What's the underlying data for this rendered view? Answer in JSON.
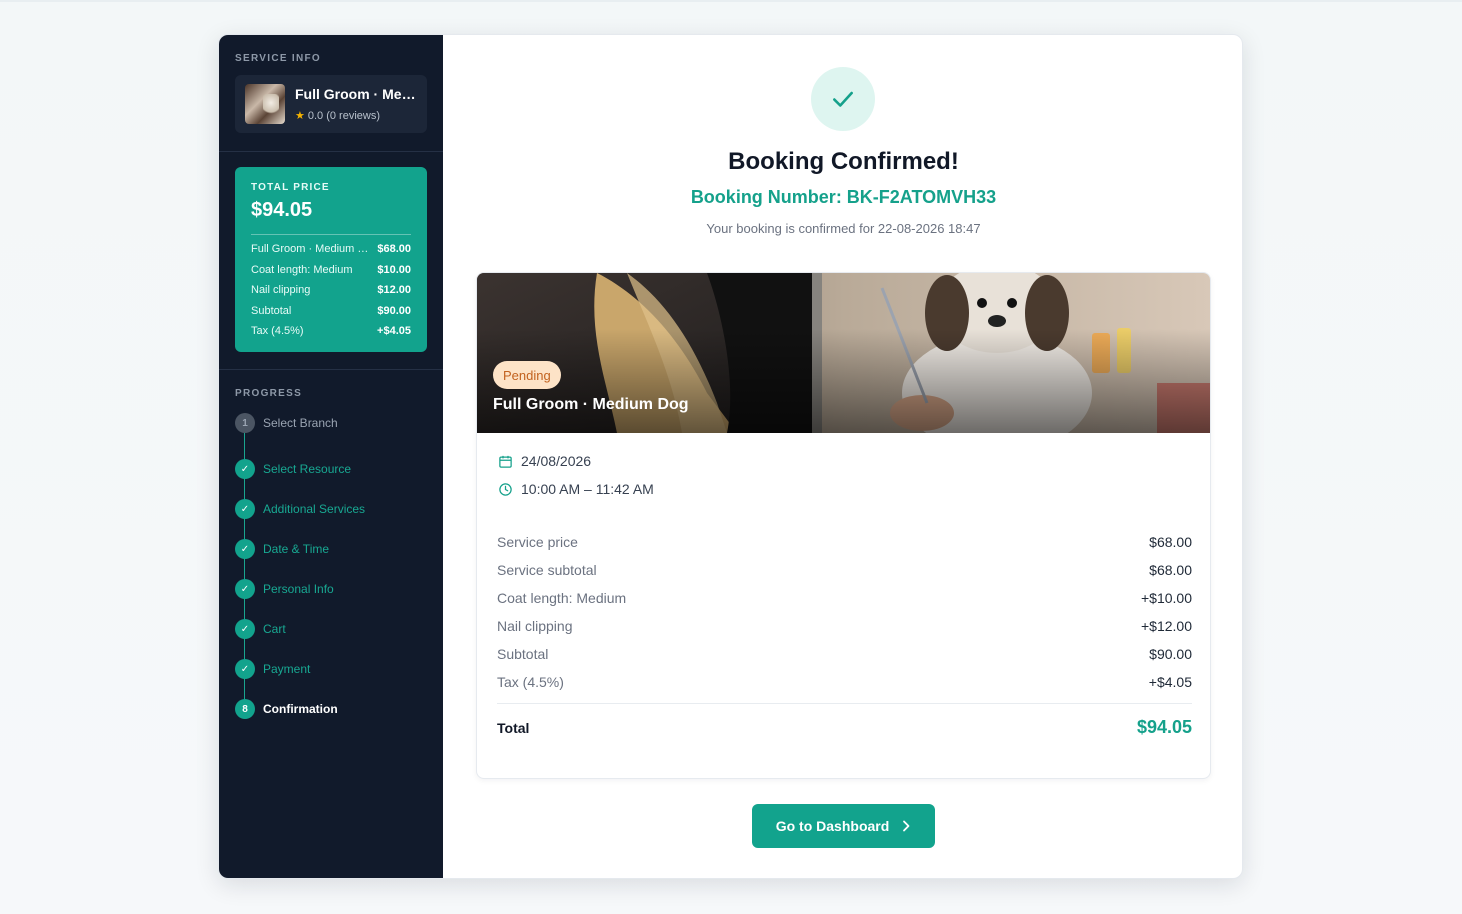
{
  "sidebar": {
    "service_info_label": "SERVICE INFO",
    "service_name": "Full Groom · Medium Dog",
    "rating": "0.0 (0 reviews)",
    "price": {
      "label": "TOTAL PRICE",
      "total": "$94.05",
      "rows": [
        {
          "label": "Full Groom · Medium Dog",
          "value": "$68.00"
        },
        {
          "label": "Coat length: Medium",
          "value": "$10.00"
        },
        {
          "label": "Nail clipping",
          "value": "$12.00"
        },
        {
          "label": "Subtotal",
          "value": "$90.00"
        },
        {
          "label": "Tax (4.5%)",
          "value": "+$4.05"
        }
      ]
    },
    "progress_label": "PROGRESS",
    "steps": [
      {
        "num": "1",
        "label": "Select Branch",
        "state": "pending"
      },
      {
        "num": "✓",
        "label": "Select Resource",
        "state": "done"
      },
      {
        "num": "✓",
        "label": "Additional Services",
        "state": "done"
      },
      {
        "num": "✓",
        "label": "Date & Time",
        "state": "done"
      },
      {
        "num": "✓",
        "label": "Personal Info",
        "state": "done"
      },
      {
        "num": "✓",
        "label": "Cart",
        "state": "done"
      },
      {
        "num": "✓",
        "label": "Payment",
        "state": "done"
      },
      {
        "num": "8",
        "label": "Confirmation",
        "state": "active"
      }
    ]
  },
  "main": {
    "title": "Booking Confirmed!",
    "booking_number": "Booking Number: BK-F2ATOMVH33",
    "subtitle": "Your booking is confirmed for 22-08-2026 18:47",
    "status_badge": "Pending",
    "service_title": "Full Groom · Medium Dog",
    "date": "24/08/2026",
    "time": "10:00 AM – 11:42 AM",
    "lines": [
      {
        "label": "Service price",
        "value": "$68.00"
      },
      {
        "label": "Service subtotal",
        "value": "$68.00"
      },
      {
        "label": "Coat length: Medium",
        "value": "+$10.00"
      },
      {
        "label": "Nail clipping",
        "value": "+$12.00"
      },
      {
        "label": "Subtotal",
        "value": "$90.00"
      },
      {
        "label": "Tax (4.5%)",
        "value": "+$4.05"
      }
    ],
    "total_label": "Total",
    "total_value": "$94.05",
    "dashboard_button": "Go to Dashboard"
  },
  "colors": {
    "accent": "#12a38d",
    "sidebar_bg": "#111a2b",
    "badge_bg": "#fde3c7",
    "badge_text": "#c2621f"
  }
}
